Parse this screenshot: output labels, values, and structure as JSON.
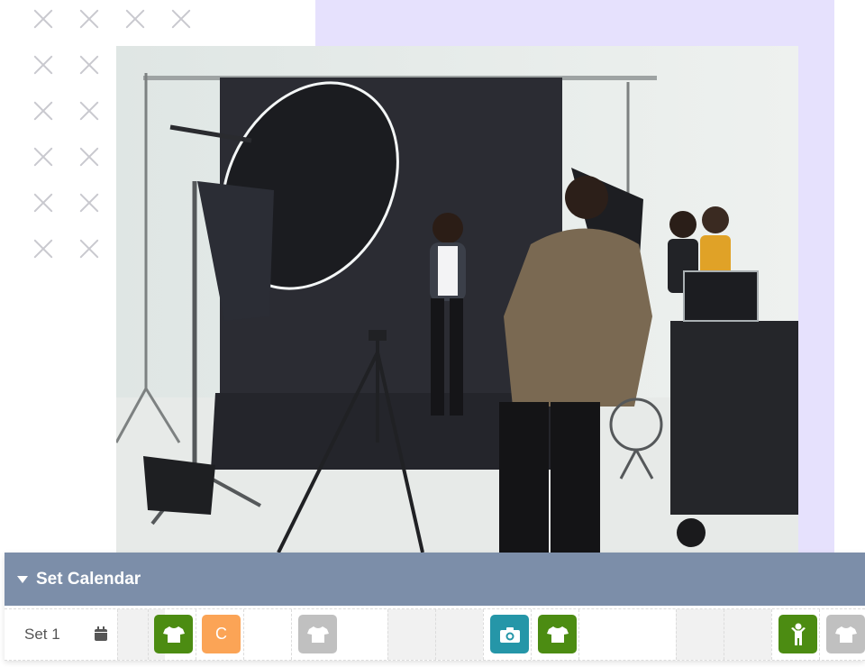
{
  "hero": {
    "image_alt": "Photographer shooting a model posing in a photo studio with lighting equipment"
  },
  "calendar": {
    "title": "Set Calendar",
    "row_label": "Set 1",
    "chips": [
      {
        "icon": "shirt-icon",
        "color": "#4c8c12",
        "label": ""
      },
      {
        "icon": "letter-c",
        "color": "#fba456",
        "label": "C"
      },
      {
        "icon": "shirt-icon",
        "color": "#c0c0c0",
        "label": ""
      },
      {
        "icon": "camera-icon",
        "color": "#2596a8",
        "label": ""
      },
      {
        "icon": "shirt-icon",
        "color": "#4c8c12",
        "label": ""
      },
      {
        "icon": "person-icon",
        "color": "#4c8c12",
        "label": ""
      },
      {
        "icon": "shirt-icon",
        "color": "#c0c0c0",
        "label": ""
      }
    ]
  },
  "colors": {
    "header_bg": "#7c8ea9",
    "lavender": "#e6e1fd",
    "green": "#4c8c12",
    "orange": "#fba456",
    "teal": "#2596a8",
    "gray": "#c0c0c0"
  }
}
